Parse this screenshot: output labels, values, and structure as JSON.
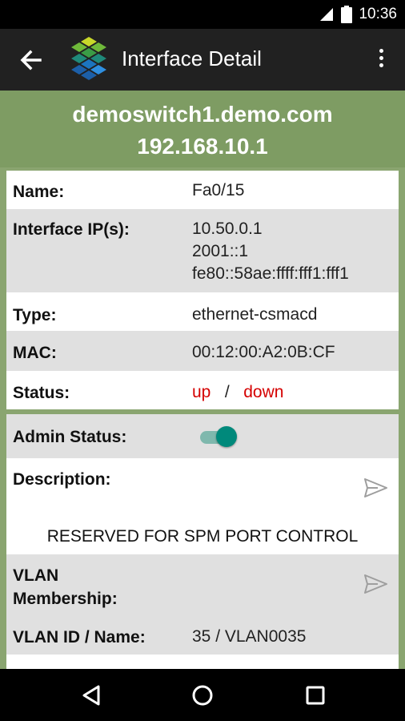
{
  "status_bar": {
    "time": "10:36"
  },
  "app_bar": {
    "title": "Interface Detail"
  },
  "device": {
    "hostname": "demoswitch1.demo.com",
    "ip": "192.168.10.1"
  },
  "details": {
    "name_label": "Name:",
    "name_value": "Fa0/15",
    "ips_label": "Interface IP(s):",
    "ips": [
      "10.50.0.1",
      "2001::1",
      "fe80::58ae:ffff:fff1:fff1"
    ],
    "type_label": "Type:",
    "type_value": "ethernet-csmacd",
    "mac_label": "MAC:",
    "mac_value": "00:12:00:A2:0B:CF",
    "status_label": "Status:",
    "status_oper": "up",
    "status_sep": "/",
    "status_admin": "down"
  },
  "config": {
    "admin_status_label": "Admin Status:",
    "admin_status_on": true,
    "description_label": "Description:",
    "description_value": "RESERVED FOR SPM PORT CONTROL",
    "vlan_membership_label_1": "VLAN",
    "vlan_membership_label_2": "Membership:",
    "vlan_id_label": "VLAN ID / Name:",
    "vlan_id_value": "35 / VLAN0035"
  },
  "colors": {
    "header": "#7e9c63",
    "status_red": "#d50000",
    "toggle": "#00897b",
    "app_bar": "#212121"
  }
}
